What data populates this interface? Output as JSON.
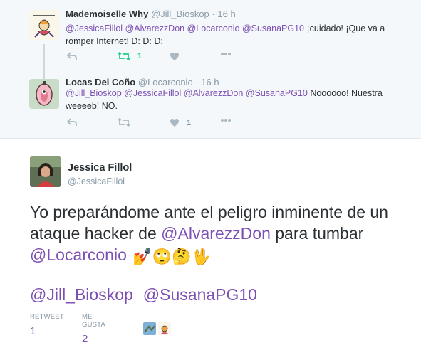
{
  "replies": [
    {
      "name": "Mademoiselle Why",
      "handle": "@Jill_Bioskop",
      "dot": "·",
      "time": "16 h",
      "text_parts": {
        "m1": "@JessicaFillol",
        "m2": "@AlvarezzDon",
        "m3": "@Locarconio",
        "m4": "@SusanaPG10",
        "rest": " ¡cuidado! ¡Que va a romper Internet! D: D: D:"
      },
      "retweets": "1",
      "likes": ""
    },
    {
      "name": "Locas Del Coño",
      "handle": "@Locarconio",
      "dot": "·",
      "time": "16 h",
      "text_parts": {
        "m1": "@Jill_Bioskop",
        "m2": "@JessicaFillol",
        "m3": "@AlvarezzDon",
        "m4": "@SusanaPG10",
        "rest": " Noooooo! Nuestra weeeeb! NO."
      },
      "retweets": "",
      "likes": "1"
    }
  ],
  "main": {
    "name": "Jessica Fillol",
    "handle": "@JessicaFillol",
    "text": {
      "p1": "Yo preparándome ante el peligro inminente de un ataque hacker de ",
      "m1": "@AlvarezzDon",
      "p2": " para tumbar ",
      "m2": "@Locarconio",
      "emoji": "💅🙄🤔🖖"
    },
    "mentions": [
      "@Jill_Bioskop",
      "@SusanaPG10"
    ],
    "stats": {
      "retweet_label": "RETWEET",
      "retweet_value": "1",
      "likes_label": "ME GUSTA",
      "likes_value": "2"
    }
  },
  "icons": {
    "reply": "reply-icon",
    "retweet": "retweet-icon",
    "like": "heart-icon",
    "more": "more-icon"
  },
  "colors": {
    "mention": "#7c50b3",
    "retweet_active": "#19cf86",
    "action": "#aab8c2"
  }
}
